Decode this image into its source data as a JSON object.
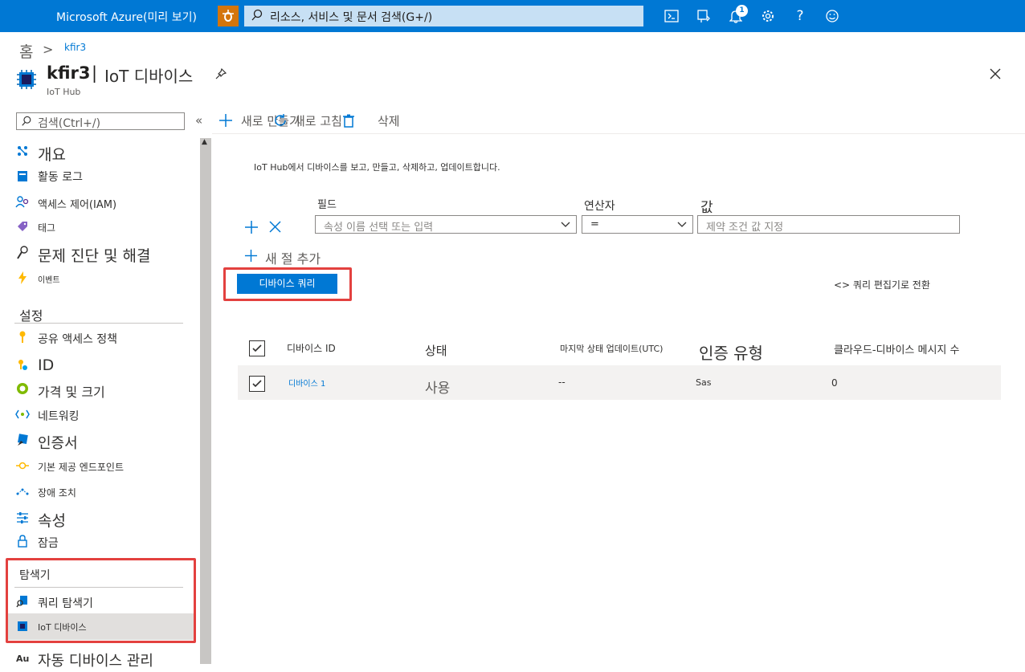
{
  "topbar": {
    "brand": "Microsoft Azure(미리 보기)",
    "search_placeholder": "리소스, 서비스 및 문서 검색(G+/)",
    "notification_count": "1",
    "icons": [
      "cloud-shell-icon",
      "directory-filter-icon",
      "notifications-icon",
      "settings-icon",
      "help-icon",
      "feedback-icon"
    ]
  },
  "breadcrumb": {
    "home": "홈",
    "separator": ">",
    "current": "kfir3"
  },
  "header": {
    "resource_name": "kfir3",
    "separator": "|",
    "blade_title": "IoT 디바이스",
    "resource_type": "IoT Hub"
  },
  "nav": {
    "search_placeholder": "검색(Ctrl+/)",
    "collapse": "«",
    "items_top": [
      {
        "label": "개요",
        "icon": "overview-icon"
      },
      {
        "label": "활동 로그",
        "icon": "activity-log-icon"
      },
      {
        "label": "액세스 제어(IAM)",
        "icon": "iam-icon"
      },
      {
        "label": "태그",
        "icon": "tag-icon"
      },
      {
        "label": "문제 진단 및 해결",
        "icon": "wrench-icon"
      },
      {
        "label": "이벤트",
        "icon": "lightning-icon"
      }
    ],
    "settings_header": "설정",
    "items_settings": [
      {
        "label": "공유 액세스 정책",
        "icon": "key-icon"
      },
      {
        "label": "ID",
        "icon": "identity-icon"
      },
      {
        "label": "가격 및 크기",
        "icon": "pricing-icon"
      },
      {
        "label": "네트워킹",
        "icon": "networking-icon"
      },
      {
        "label": "인증서",
        "icon": "certificate-icon"
      },
      {
        "label": "기본 제공 엔드포인트",
        "icon": "endpoint-icon"
      },
      {
        "label": "장애 조치",
        "icon": "failover-icon"
      },
      {
        "label": "속성",
        "icon": "properties-icon"
      },
      {
        "label": "잠금",
        "icon": "lock-icon"
      }
    ],
    "explorer_header": "탐색기",
    "items_explorer": [
      {
        "label": "쿼리 탐색기",
        "icon": "query-explorer-icon"
      },
      {
        "label": "IoT 디바이스",
        "icon": "iot-device-icon"
      }
    ],
    "next_item_prefix": "Au",
    "next_item_label": "자동 디바이스 관리"
  },
  "commands": {
    "new": "새로 만들기",
    "refresh": "새로 고침",
    "delete": "삭제"
  },
  "main": {
    "description": "IoT Hub에서 디바이스를 보고, 만들고, 삭제하고, 업데이트합니다.",
    "filter": {
      "field_label": "필드",
      "field_placeholder": "속성 이름 선택 또는 입력",
      "operator_label": "연산자",
      "operator_value": "=",
      "value_label": "값",
      "value_placeholder": "제약 조건 값 지정",
      "add_clause": "새 절 추가"
    },
    "query_button": "디바이스 쿼리",
    "switch_editor": "<> 쿼리 편집기로 전환",
    "table": {
      "headers": [
        "디바이스 ID",
        "상태",
        "마지막 상태 업데이트(UTC)",
        "인증 유형",
        "클라우드-디바이스 메시지 수"
      ],
      "rows": [
        {
          "device_id": "디바이스 1",
          "status": "사용",
          "last_update": "--",
          "auth_type": "Sas",
          "messages": "0"
        }
      ]
    }
  }
}
